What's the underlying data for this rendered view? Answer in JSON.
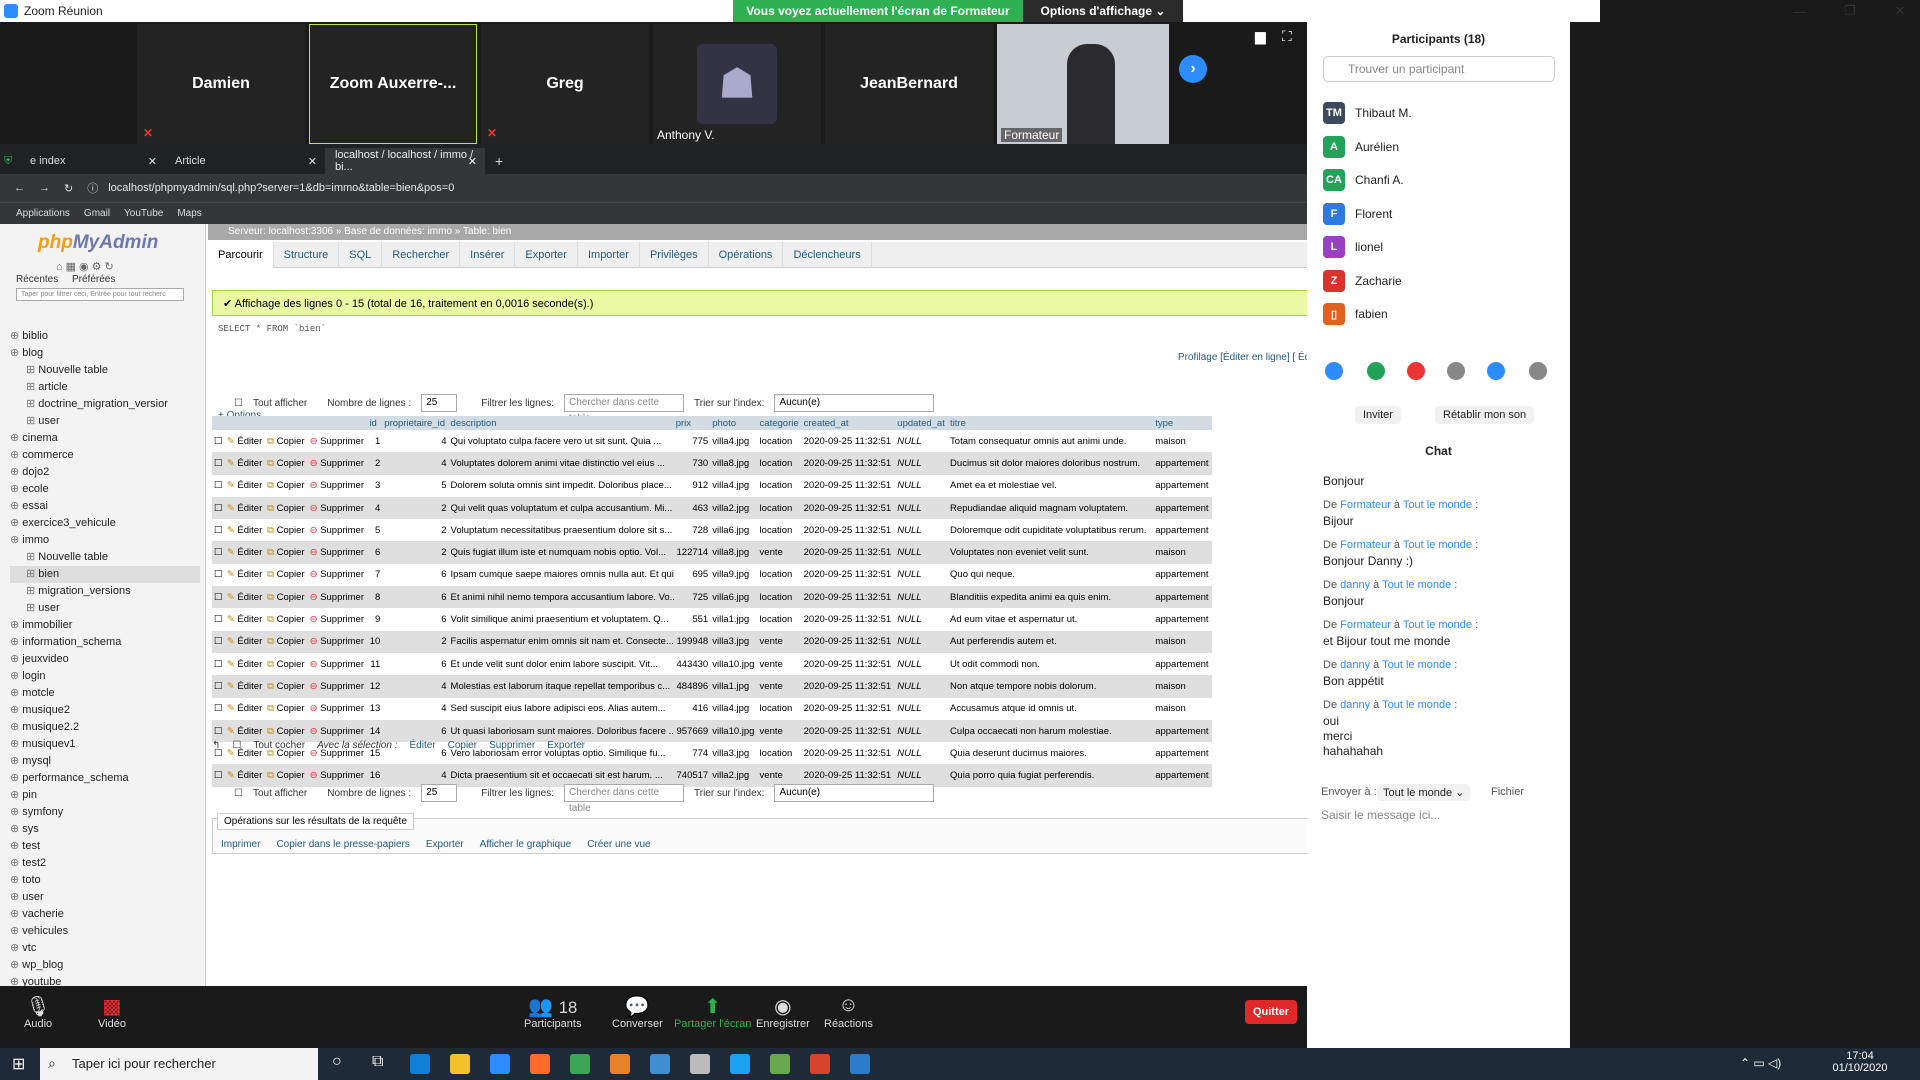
{
  "zoom": {
    "window_title": "Zoom Réunion",
    "share_banner": "Vous voyez actuellement l'écran de Formateur",
    "view_options": "Options d'affichage ⌄",
    "tiles": [
      {
        "name": "Damien",
        "muted": true
      },
      {
        "name": "Zoom  Auxerre-...",
        "muted": false
      },
      {
        "name": "Greg",
        "muted": true
      },
      {
        "name": "Anthony V.",
        "muted": false
      },
      {
        "name": "JeanBernard",
        "muted": false
      },
      {
        "name": "Formateur",
        "muted": false
      }
    ],
    "bottom": {
      "audio": "Audio",
      "video": "Vidéo",
      "participants": "Participants",
      "participants_count": "18",
      "chat": "Converser",
      "share": "Partager l'écran",
      "record": "Enregistrer",
      "reactions": "Réactions",
      "quit": "Quitter"
    }
  },
  "participants_panel": {
    "title": "Participants (18)",
    "search_placeholder": "Trouver un participant",
    "list": [
      {
        "initials": "TM",
        "name": "Thibaut M.",
        "color": "#3b4a5c"
      },
      {
        "initials": "A",
        "name": "Aurélien",
        "color": "#23a35a"
      },
      {
        "initials": "CA",
        "name": "Chanfi A.",
        "color": "#23a35a"
      },
      {
        "initials": "F",
        "name": "Florent",
        "color": "#2d7be0"
      },
      {
        "initials": "L",
        "name": "lionel",
        "color": "#9b3fc4"
      },
      {
        "initials": "Z",
        "name": "Zacharie",
        "color": "#d9342b"
      },
      {
        "initials": "▯",
        "name": "fabien",
        "color": "#e0611f"
      }
    ],
    "invite": "Inviter",
    "restore_sound": "Rétablir mon son"
  },
  "chat": {
    "title": "Chat",
    "messages": [
      {
        "from": "",
        "to": "",
        "text": "Bonjour"
      },
      {
        "from": "Formateur",
        "to": "Tout le monde",
        "text": "Bijour"
      },
      {
        "from": "Formateur",
        "to": "Tout le monde",
        "text": "Bonjour Danny :)"
      },
      {
        "from": "danny",
        "to": "Tout le monde",
        "text": "Bonjour"
      },
      {
        "from": "Formateur",
        "to": "Tout le monde",
        "text": "et Bijour tout me monde"
      },
      {
        "from": "danny",
        "to": "Tout le monde",
        "text": "Bon appétit"
      },
      {
        "from": "danny",
        "to": "Tout le monde",
        "text": "oui\nmerci\nhahahahah"
      }
    ],
    "send_to_label": "Envoyer à :",
    "send_to_value": "Tout le monde ⌄",
    "file_label": "Fichier",
    "input_placeholder": "Saisir le message ici..."
  },
  "browser": {
    "tabs": [
      {
        "label": "e index"
      },
      {
        "label": "Article"
      },
      {
        "label": "localhost / localhost / immo / bi..."
      }
    ],
    "url": "localhost/phpmyadmin/sql.php?server=1&db=immo&table=bien&pos=0",
    "bookmarks": [
      "Applications",
      "Gmail",
      "YouTube",
      "Maps"
    ]
  },
  "pma": {
    "logo_php": "php",
    "logo_myadmin": "MyAdmin",
    "recent": "Récentes",
    "favorites": "Préférées",
    "filter_placeholder": "Taper pour filtrer ceci, Entrée pour tout recherc",
    "tree": [
      {
        "label": "biblio",
        "indent": 0
      },
      {
        "label": "blog",
        "indent": 0
      },
      {
        "label": "Nouvelle table",
        "indent": 2
      },
      {
        "label": "article",
        "indent": 2
      },
      {
        "label": "doctrine_migration_versior",
        "indent": 2
      },
      {
        "label": "user",
        "indent": 2
      },
      {
        "label": "cinema",
        "indent": 0
      },
      {
        "label": "commerce",
        "indent": 0
      },
      {
        "label": "dojo2",
        "indent": 0
      },
      {
        "label": "ecole",
        "indent": 0
      },
      {
        "label": "essai",
        "indent": 0
      },
      {
        "label": "exercice3_vehicule",
        "indent": 0
      },
      {
        "label": "immo",
        "indent": 0
      },
      {
        "label": "Nouvelle table",
        "indent": 2
      },
      {
        "label": "bien",
        "indent": 2
      },
      {
        "label": "migration_versions",
        "indent": 2
      },
      {
        "label": "user",
        "indent": 2
      },
      {
        "label": "immobilier",
        "indent": 0
      },
      {
        "label": "information_schema",
        "indent": 0
      },
      {
        "label": "jeuxvideo",
        "indent": 0
      },
      {
        "label": "login",
        "indent": 0
      },
      {
        "label": "motcle",
        "indent": 0
      },
      {
        "label": "musique2",
        "indent": 0
      },
      {
        "label": "musique2.2",
        "indent": 0
      },
      {
        "label": "musiquev1",
        "indent": 0
      },
      {
        "label": "mysql",
        "indent": 0
      },
      {
        "label": "performance_schema",
        "indent": 0
      },
      {
        "label": "pin",
        "indent": 0
      },
      {
        "label": "symfony",
        "indent": 0
      },
      {
        "label": "sys",
        "indent": 0
      },
      {
        "label": "test",
        "indent": 0
      },
      {
        "label": "test2",
        "indent": 0
      },
      {
        "label": "toto",
        "indent": 0
      },
      {
        "label": "user",
        "indent": 0
      },
      {
        "label": "vacherie",
        "indent": 0
      },
      {
        "label": "vehicules",
        "indent": 0
      },
      {
        "label": "vtc",
        "indent": 0
      },
      {
        "label": "wp_blog",
        "indent": 0
      },
      {
        "label": "youtube",
        "indent": 0
      }
    ],
    "breadcrumb": "Serveur: localhost:3306 » Base de données: immo » Table: bien",
    "tabs": [
      "Parcourir",
      "Structure",
      "SQL",
      "Rechercher",
      "Insérer",
      "Exporter",
      "Importer",
      "Privilèges",
      "Opérations",
      "Déclencheurs"
    ],
    "success": "✔ Affichage des lignes 0 - 15 (total de 16, traitement en 0,0016 seconde(s).)",
    "sql": "SELECT * FROM `bien`",
    "profiling": "Profilage [Éditer en ligne] [ Éditer ] [ Expliquer SQL ] [ Créer le code source PHP ] [ Actualiser]",
    "controls": {
      "show_all": "Tout afficher",
      "rows_label": "Nombre de lignes :",
      "rows_value": "25",
      "filter_label": "Filtrer les lignes:",
      "filter_placeholder": "Chercher dans cette table",
      "sort_label": "Trier sur l'index:",
      "sort_value": "Aucun(e)"
    },
    "options": "+ Options",
    "columns": [
      "id",
      "proprietaire_id",
      "description",
      "prix",
      "photo",
      "categorie",
      "created_at",
      "updated_at",
      "titre",
      "type"
    ],
    "actions": {
      "edit": "Éditer",
      "copy": "Copier",
      "delete": "Supprimer"
    },
    "rows": [
      [
        "1",
        "4",
        "Qui voluptato culpa facere vero ut sit sunt. Quia ...",
        "775",
        "villa4.jpg",
        "location",
        "2020-09-25 11:32:51",
        "NULL",
        "Totam consequatur omnis aut animi unde.",
        "maison"
      ],
      [
        "2",
        "4",
        "Voluptates dolorem animi vitae distinctio vel eius ...",
        "730",
        "villa8.jpg",
        "location",
        "2020-09-25 11:32:51",
        "NULL",
        "Ducimus sit dolor maiores doloribus nostrum.",
        "appartement"
      ],
      [
        "3",
        "5",
        "Dolorem soluta omnis sint impedit. Doloribus place...",
        "912",
        "villa4.jpg",
        "location",
        "2020-09-25 11:32:51",
        "NULL",
        "Amet ea et molestiae vel.",
        "appartement"
      ],
      [
        "4",
        "2",
        "Qui velit quas voluptatum et culpa accusantium. Mi...",
        "463",
        "villa2.jpg",
        "location",
        "2020-09-25 11:32:51",
        "NULL",
        "Repudiandae aliquid magnam voluptatem.",
        "appartement"
      ],
      [
        "5",
        "2",
        "Voluptatum necessitatibus praesentium dolore sit s...",
        "728",
        "villa6.jpg",
        "location",
        "2020-09-25 11:32:51",
        "NULL",
        "Doloremque odit cupiditate voluptatibus rerum.",
        "appartement"
      ],
      [
        "6",
        "2",
        "Quis fugiat illum iste et numquam nobis optio. Vol...",
        "122714",
        "villa8.jpg",
        "vente",
        "2020-09-25 11:32:51",
        "NULL",
        "Voluptates non eveniet velit sunt.",
        "maison"
      ],
      [
        "7",
        "6",
        "Ipsam cumque saepe maiores omnis nulla aut. Et qui...",
        "695",
        "villa9.jpg",
        "location",
        "2020-09-25 11:32:51",
        "NULL",
        "Quo qui neque.",
        "appartement"
      ],
      [
        "8",
        "6",
        "Et animi nihil nemo tempora accusantium labore. Vo...",
        "725",
        "villa6.jpg",
        "location",
        "2020-09-25 11:32:51",
        "NULL",
        "Blanditiis expedita animi ea quis enim.",
        "appartement"
      ],
      [
        "9",
        "6",
        "Volit similique animi praesentium et voluptatem. Q...",
        "551",
        "villa1.jpg",
        "location",
        "2020-09-25 11:32:51",
        "NULL",
        "Ad eum vitae et aspernatur ut.",
        "appartement"
      ],
      [
        "10",
        "2",
        "Facilis aspernatur enim omnis sit nam et. Consecte...",
        "199948",
        "villa3.jpg",
        "vente",
        "2020-09-25 11:32:51",
        "NULL",
        "Aut perferendis autem et.",
        "maison"
      ],
      [
        "11",
        "6",
        "Et unde velit sunt dolor enim labore suscipit. Vit...",
        "443430",
        "villa10.jpg",
        "vente",
        "2020-09-25 11:32:51",
        "NULL",
        "Ut odit commodi non.",
        "appartement"
      ],
      [
        "12",
        "4",
        "Molestias est laborum itaque repellat temporibus c...",
        "484896",
        "villa1.jpg",
        "vente",
        "2020-09-25 11:32:51",
        "NULL",
        "Non atque tempore nobis dolorum.",
        "maison"
      ],
      [
        "13",
        "4",
        "Sed suscipit eius labore adipisci eos. Alias autem...",
        "416",
        "villa4.jpg",
        "location",
        "2020-09-25 11:32:51",
        "NULL",
        "Accusamus atque id omnis ut.",
        "maison"
      ],
      [
        "14",
        "6",
        "Ut quasi laboriosam sunt maiores. Doloribus facere ...",
        "957669",
        "villa10.jpg",
        "vente",
        "2020-09-25 11:32:51",
        "NULL",
        "Culpa occaecati non harum molestiae.",
        "appartement"
      ],
      [
        "15",
        "6",
        "Vero laboriosam error voluptas optio. Similique fu...",
        "774",
        "villa3.jpg",
        "location",
        "2020-09-25 11:32:51",
        "NULL",
        "Quia deserunt ducimus maiores.",
        "appartement"
      ],
      [
        "16",
        "4",
        "Dicta praesentium sit et occaecati sit est harum. ...",
        "740517",
        "villa2.jpg",
        "vente",
        "2020-09-25 11:32:51",
        "NULL",
        "Quia porro quia fugiat perferendis.",
        "appartement"
      ]
    ],
    "bulk": {
      "check_all": "Tout cocher",
      "with_selection": "Avec la sélection :",
      "edit": "Éditer",
      "copy": "Copier",
      "delete": "Supprimer",
      "export": "Exporter"
    },
    "query_ops_title": "Opérations sur les résultats de la requête",
    "query_ops": [
      "Imprimer",
      "Copier dans le presse-papiers",
      "Exporter",
      "Afficher le graphique",
      "Créer une vue"
    ]
  },
  "taskbar": {
    "search": "Taper ici pour rechercher",
    "time": "17:04",
    "date": "01/10/2020"
  }
}
